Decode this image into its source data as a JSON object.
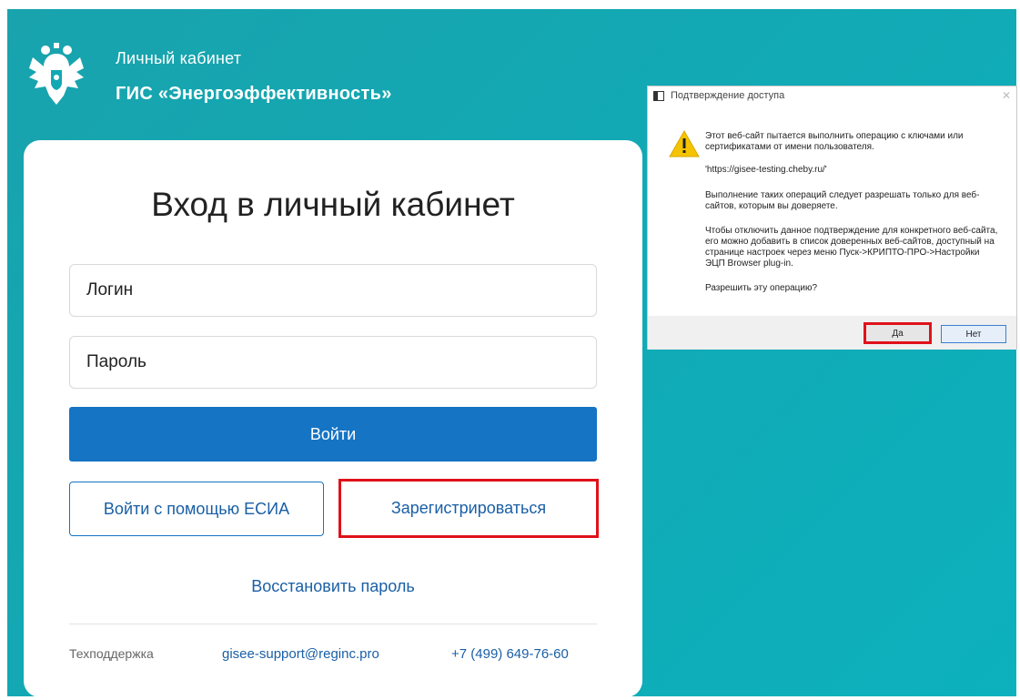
{
  "header": {
    "subtitle": "Личный кабинет",
    "title": "ГИС «Энергоэффективность»"
  },
  "login_card": {
    "title": "Вход в личный кабинет",
    "login_placeholder": "Логин",
    "password_placeholder": "Пароль",
    "login_button": "Войти",
    "esia_button": "Войти с помощью ЕСИА",
    "register_button": "Зарегистрироваться",
    "restore_link": "Восстановить пароль",
    "footer": {
      "support_label": "Техподдержка",
      "email": "gisee-support@reginc.pro",
      "phone": "+7 (499) 649-76-60"
    }
  },
  "dialog": {
    "title": "Подтверждение доступа",
    "close_symbol": "✕",
    "message1": "Этот веб-сайт пытается выполнить операцию с ключами или сертификатами от имени пользователя.",
    "url": "'https://gisee-testing.cheby.ru/'",
    "message2": "Выполнение таких операций следует разрешать только для веб-сайтов, которым вы доверяете.",
    "message3": "Чтобы отключить данное подтверждение для конкретного веб-сайта, его можно добавить в список доверенных веб-сайтов, доступный на странице настроек через меню Пуск->КРИПТО-ПРО->Настройки ЭЦП Browser plug-in.",
    "question": "Разрешить эту операцию?",
    "yes_button": "Да",
    "no_button": "Нет"
  },
  "colors": {
    "background": "#12a9b4",
    "primary_button": "#1574c4",
    "link": "#1a5fa6",
    "highlight": "#e0121a"
  }
}
